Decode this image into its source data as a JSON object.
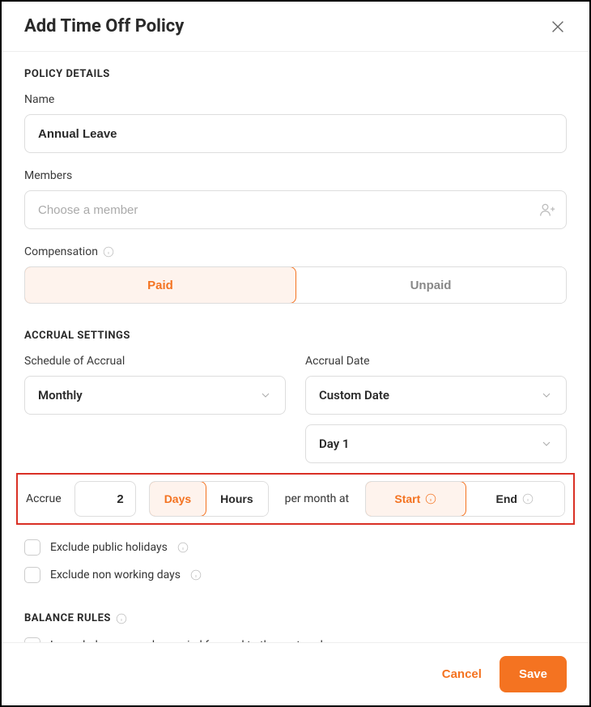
{
  "modal": {
    "title": "Add Time Off Policy"
  },
  "policyDetails": {
    "sectionTitle": "POLICY DETAILS",
    "nameLabel": "Name",
    "nameValue": "Annual Leave",
    "membersLabel": "Members",
    "membersPlaceholder": "Choose a member",
    "compensationLabel": "Compensation",
    "compensation": {
      "paid": "Paid",
      "unpaid": "Unpaid"
    }
  },
  "accrual": {
    "sectionTitle": "ACCRUAL SETTINGS",
    "scheduleLabel": "Schedule of Accrual",
    "scheduleValue": "Monthly",
    "dateLabel": "Accrual Date",
    "dateValue": "Custom Date",
    "dayValue": "Day 1",
    "accrueLabel": "Accrue",
    "accrueAmount": "2",
    "unitDays": "Days",
    "unitHours": "Hours",
    "perMonthAt": "per month at",
    "start": "Start",
    "end": "End",
    "excludeHolidays": "Exclude public holidays",
    "excludeNonWorking": "Exclude non working days"
  },
  "balance": {
    "sectionTitle": "BALANCE RULES",
    "carryForward": "Leave balances can be carried forward to the next cycle"
  },
  "footer": {
    "cancel": "Cancel",
    "save": "Save"
  }
}
